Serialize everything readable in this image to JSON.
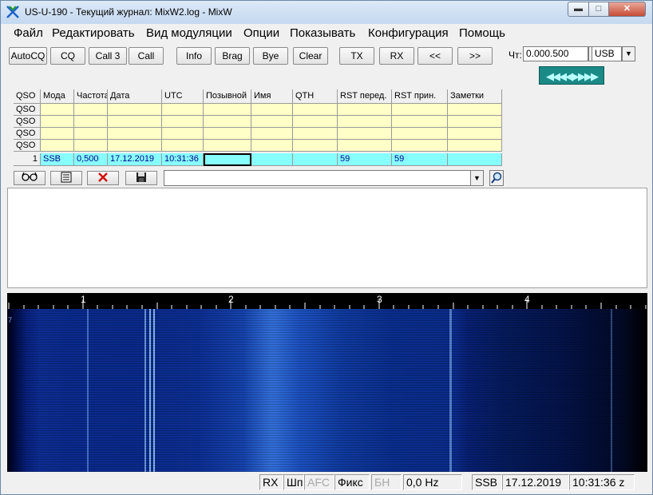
{
  "window": {
    "title": "US-U-190 - Текущий журнал: MixW2.log - MixW",
    "controls": {
      "minimize": "▬",
      "maximize": "□",
      "close": "✕"
    }
  },
  "menu": [
    "Файл",
    "Редактировать",
    "Вид модуляции",
    "Опции",
    "Показывать",
    "Конфигурация",
    "Помощь"
  ],
  "toolbar": {
    "buttons": [
      "AutoCQ",
      "CQ",
      "Call 3",
      "Call",
      "Info",
      "Brag",
      "Bye",
      "Clear",
      "TX",
      "RX",
      "<<",
      ">>"
    ]
  },
  "rig": {
    "freq_label": "Чт:",
    "freq_value": "0.000.500",
    "mode_value": "USB",
    "tune_bar": "◀◀◀◀▶▶▶▶"
  },
  "log": {
    "headers": [
      "QSO",
      "Мода",
      "Частота, RX",
      "Дата",
      "UTC",
      "Позывной",
      "Имя",
      "QTH",
      "RST перед.",
      "RST прин.",
      "Заметки"
    ],
    "previous_rows": [
      "QSO",
      "QSO",
      "QSO",
      "QSO"
    ],
    "current_row": {
      "num": "1",
      "mode": "SSB",
      "freq": "0,500",
      "date": "17.12.2019",
      "utc": "10:31:36",
      "call": "",
      "name": "",
      "qth": "",
      "rst_sent": "59",
      "rst_rcvd": "59",
      "notes": ""
    }
  },
  "logtools": {
    "combo_value": ""
  },
  "waterfall": {
    "ruler_labels": [
      "1",
      "2",
      "3",
      "4"
    ],
    "scale_unit_hint": "7"
  },
  "status": {
    "rx": "RX",
    "sql": "Шп",
    "afc": "AFC",
    "fix": "Фикс",
    "nb": "БН",
    "offset": "0,0 Hz",
    "mode": "SSB",
    "date": "17.12.2019",
    "time": "10:31:36 z"
  },
  "colors": {
    "log_current_row": "#88ffff",
    "log_empty_row": "#ffffc8",
    "tune_bar": "#1b8a86",
    "waterfall_bg": "#000000"
  }
}
